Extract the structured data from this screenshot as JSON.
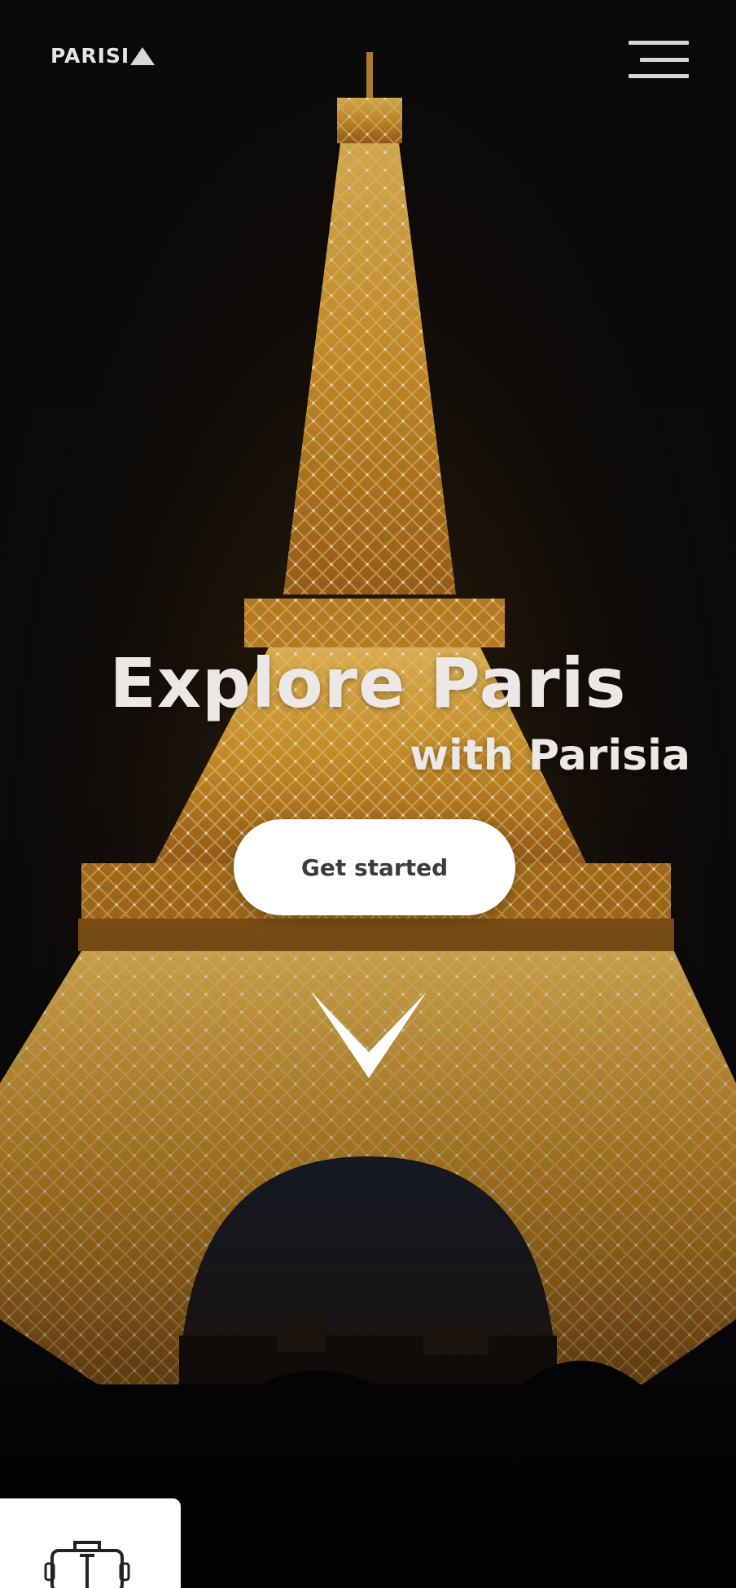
{
  "brand": {
    "name": "PARISI",
    "logo_mark": "triangle-icon"
  },
  "header": {
    "menu_icon": "hamburger-menu-icon"
  },
  "hero": {
    "title": "Explore Paris",
    "subtitle": "with Parisia",
    "cta_label": "Get started",
    "scroll_icon": "chevron-down-icon",
    "background": "eiffel-tower-night-photo"
  },
  "bottom_card": {
    "icon": "luggage-icon"
  },
  "colors": {
    "text_primary": "#ece8e6",
    "cta_background": "#ffffff",
    "cta_text": "#3c3c3c",
    "tower_gold": "#e0a53a",
    "sky": "#0c0b0d"
  }
}
